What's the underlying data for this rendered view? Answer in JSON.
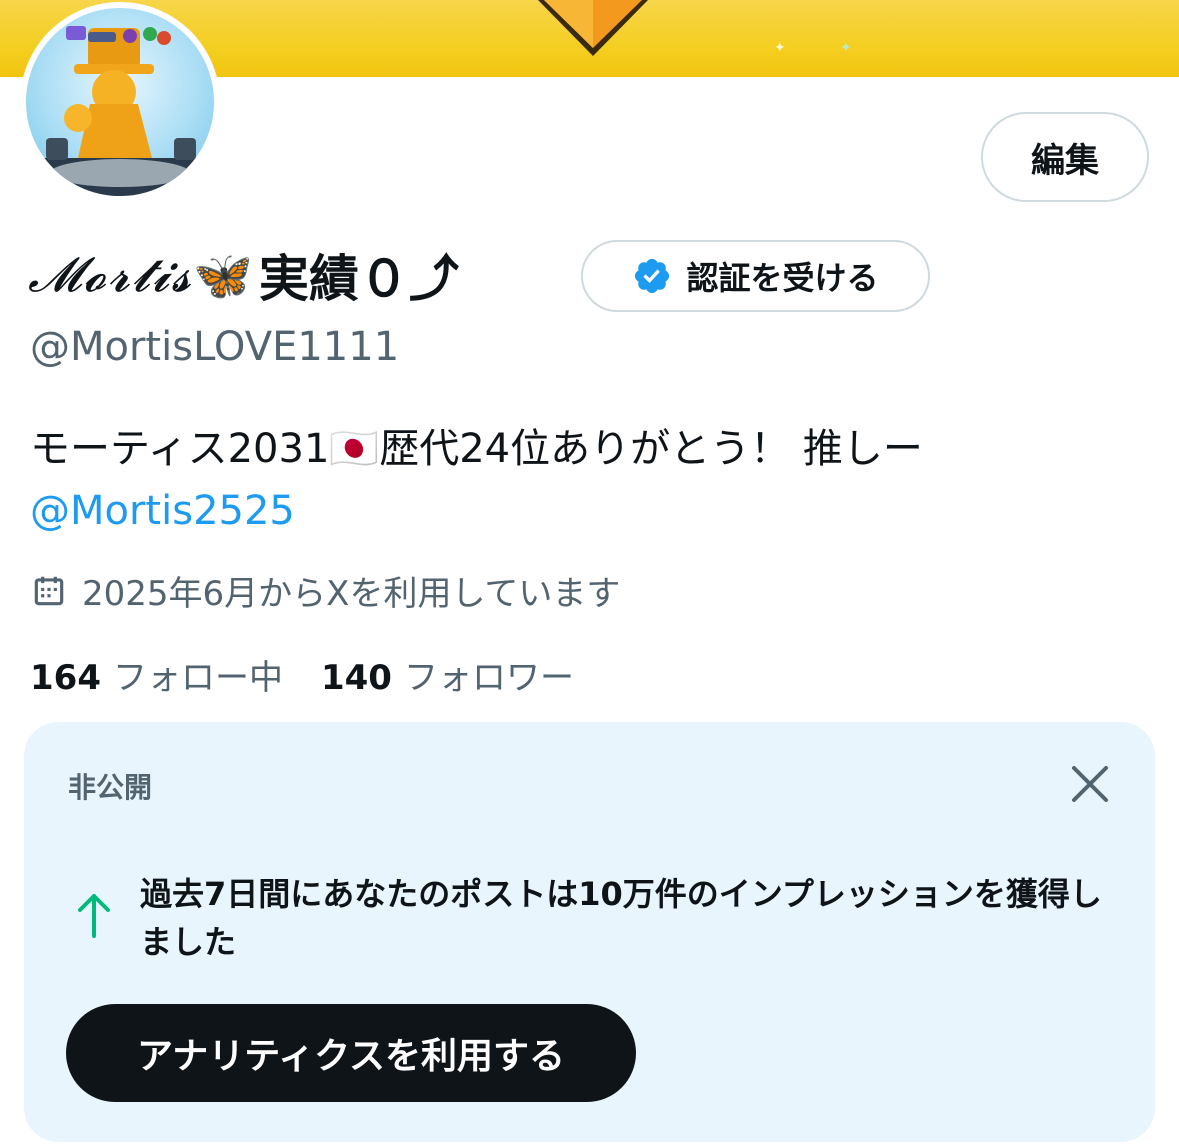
{
  "profile": {
    "name_script": "𝓜𝓸𝓻𝓽𝓲𝓼",
    "name_emoji": "🦋",
    "name_suffix": "実績０⤴︎",
    "handle": "@MortisLOVE1111",
    "bio_line1": "モーティス2031🇯🇵歴代24位ありがとう！ 推しー",
    "bio_mention": "@Mortis2525",
    "joined": "2025年6月からXを利用しています",
    "following_count": "164",
    "following_label": "フォロー中",
    "followers_count": "140",
    "followers_label": "フォロワー"
  },
  "actions": {
    "edit_label": "編集",
    "verify_label": "認証を受ける"
  },
  "insight_card": {
    "label": "非公開",
    "message": "過去7日間にあなたのポストは10万件のインプレッションを獲得しました",
    "button_label": "アナリティクスを利用する"
  },
  "colors": {
    "banner": "#f4cf22",
    "link": "#1d9bf0",
    "verified_badge": "#1d9bf0",
    "growth_arrow": "#00ba7c",
    "card_bg": "#e8f5fd",
    "button_dark": "#0f1419"
  },
  "icons": {
    "verified": "verified-badge-icon",
    "calendar": "calendar-icon",
    "close": "close-icon",
    "arrow": "arrow-up-icon"
  }
}
